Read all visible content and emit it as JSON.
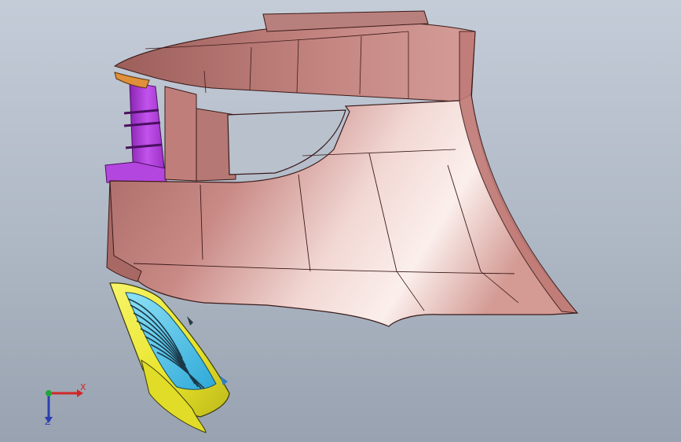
{
  "viewport": {
    "background_top": "#c4ccd8",
    "background_bottom": "#98a2b0"
  },
  "model": {
    "parts": [
      {
        "name": "bumper-cover",
        "color": "#c98a86"
      },
      {
        "name": "side-bracket",
        "color": "#b03ad8"
      },
      {
        "name": "grille-frame",
        "color": "#e8e42a"
      },
      {
        "name": "grille-slats",
        "color": "#48c6e8"
      },
      {
        "name": "turn-signal-lens",
        "color": "#e0903a"
      }
    ]
  },
  "triad": {
    "x_label": "X",
    "z_label": "Z",
    "x_color": "#d02828",
    "y_color": "#1fa83a",
    "z_color": "#2a3fb0"
  }
}
